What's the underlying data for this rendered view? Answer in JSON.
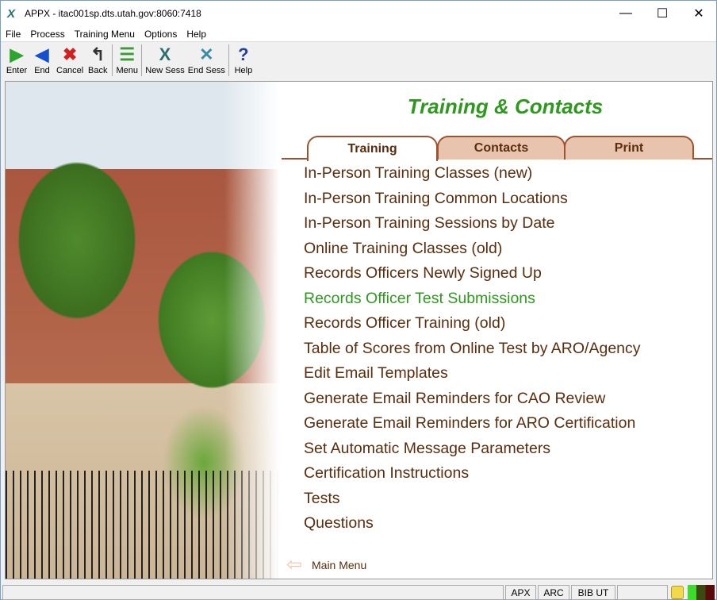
{
  "window": {
    "title": "APPX - itac001sp.dts.utah.gov:8060:7418",
    "minimize": "—",
    "maximize": "☐",
    "close": "✕"
  },
  "menubar": [
    "File",
    "Process",
    "Training Menu",
    "Options",
    "Help"
  ],
  "toolbar": [
    {
      "label": "Enter",
      "icon": "play-icon",
      "glyph": "▶",
      "color": "#2ea52e"
    },
    {
      "label": "End",
      "icon": "back-arrow-icon",
      "glyph": "◀",
      "color": "#1450d0"
    },
    {
      "label": "Cancel",
      "icon": "cancel-icon",
      "glyph": "✖",
      "color": "#d02020"
    },
    {
      "label": "Back",
      "icon": "back-step-icon",
      "glyph": "↰",
      "color": "#333"
    },
    {
      "label": "Menu",
      "icon": "list-icon",
      "glyph": "☰",
      "color": "#3a9a3a"
    },
    {
      "label": "New Sess",
      "icon": "new-session-icon",
      "glyph": "X",
      "color": "#2a6e6e"
    },
    {
      "label": "End Sess",
      "icon": "end-session-icon",
      "glyph": "✕",
      "color": "#3a8aa8"
    },
    {
      "label": "Help",
      "icon": "help-icon",
      "glyph": "?",
      "color": "#2040a0"
    }
  ],
  "page": {
    "heading": "Training & Contacts",
    "tabs": [
      "Training",
      "Contacts",
      "Print"
    ],
    "items": [
      "In-Person Training Classes (new)",
      "In-Person Training Common Locations",
      "In-Person Training Sessions by Date",
      "Online Training Classes (old)",
      "Records Officers Newly Signed Up",
      "Records Officer Test Submissions",
      "Records Officer Training (old)",
      "Table of Scores from Online Test by ARO/Agency",
      "Edit Email Templates",
      "Generate Email Reminders for CAO Review",
      "Generate Email Reminders for ARO Certification",
      "Set Automatic Message Parameters",
      "Certification Instructions",
      "Tests",
      "Questions"
    ],
    "highlighted_index": 5,
    "main_menu": "Main Menu"
  },
  "status": [
    "APX",
    "ARC",
    "BIB UT"
  ],
  "colors": {
    "accent": "#2e9a1d",
    "text": "#5a2d0c",
    "tab": "#e8c4ae"
  }
}
